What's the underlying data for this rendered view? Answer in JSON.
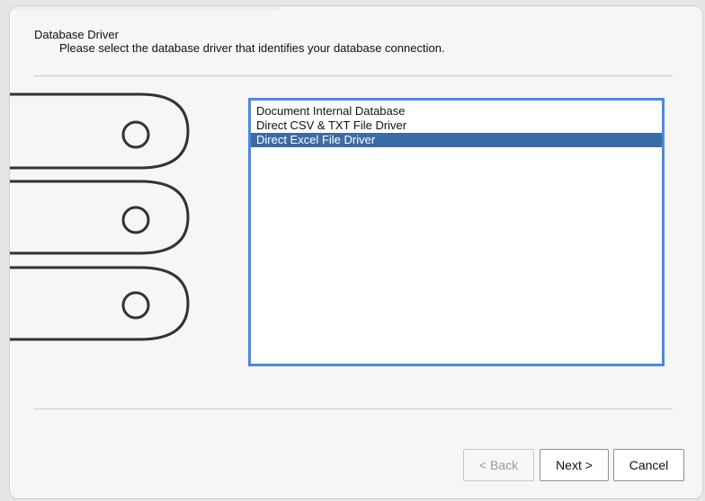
{
  "dialog": {
    "title": "Database Driver",
    "subtitle": "Please select the database driver that identifies your database connection."
  },
  "illustration": {
    "icon": "database-disks-icon",
    "disks": 3
  },
  "driver_list": {
    "items": [
      {
        "label": "Document Internal Database",
        "selected": false
      },
      {
        "label": "Direct CSV & TXT File Driver",
        "selected": false
      },
      {
        "label": "Direct Excel File Driver",
        "selected": true
      }
    ]
  },
  "buttons": {
    "back_label": "< Back",
    "back_enabled": false,
    "next_label": "Next >",
    "cancel_label": "Cancel"
  },
  "colors": {
    "selection": "#3b6ba5",
    "focus_border": "#4a8ae6",
    "dialog_background": "#f6f6f6"
  }
}
